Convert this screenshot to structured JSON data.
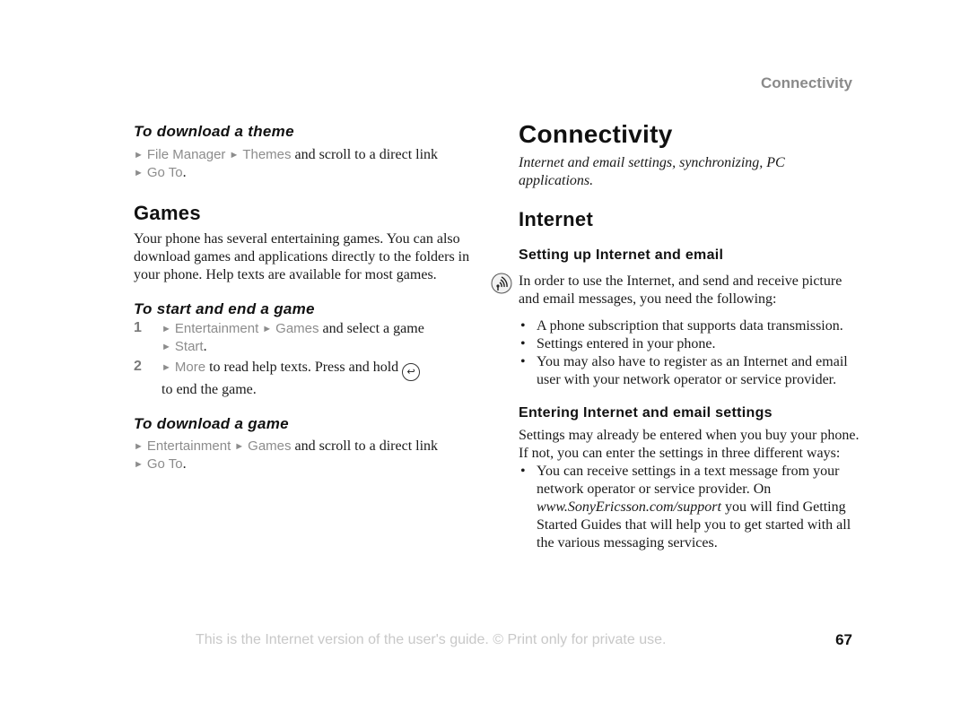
{
  "header": {
    "running_title": "Connectivity"
  },
  "left": {
    "download_theme": {
      "heading": "To download a theme",
      "menu1": "File Manager",
      "menu2": "Themes",
      "text": " and scroll to a direct link",
      "menu3": "Go To",
      "end": "."
    },
    "games": {
      "heading": "Games",
      "body": "Your phone has several entertaining games. You can also download games and applications directly to the folders in your phone. Help texts are available for most games."
    },
    "start_end_game": {
      "heading": "To start and end a game",
      "steps": [
        {
          "num": "1",
          "menu1": "Entertainment",
          "menu2": "Games",
          "text": " and select a game",
          "menu3": "Start",
          "end": "."
        },
        {
          "num": "2",
          "menu1": "More",
          "text": " to read help texts. Press and hold ",
          "icon": "back-key-icon",
          "text2": " to end the game."
        }
      ]
    },
    "download_game": {
      "heading": "To download a game",
      "menu1": "Entertainment",
      "menu2": "Games",
      "text": " and scroll to a direct link",
      "menu3": "Go To",
      "end": "."
    }
  },
  "right": {
    "title": "Connectivity",
    "subtitle": "Internet and email settings, synchronizing, PC applications.",
    "internet": {
      "heading": "Internet",
      "setup": {
        "heading": "Setting up Internet and email",
        "icon": "operator-service-icon",
        "intro": "In order to use the Internet, and send and receive picture and email messages, you need the following:",
        "bullets": [
          "A phone subscription that supports data transmission.",
          "Settings entered in your phone.",
          "You may also have to register as an Internet and email user with your network operator or service provider."
        ]
      },
      "entering": {
        "heading": "Entering Internet and email settings",
        "intro": "Settings may already be entered when you buy your phone. If not, you can enter the settings in three different ways:",
        "bullet_a": "You can receive settings in a text message from your network operator or service provider. On ",
        "bullet_link": "www.SonyEricsson.com/support",
        "bullet_b": " you will find Getting Started Guides that will help you to get started with all the various messaging services."
      }
    }
  },
  "footer": {
    "note": "This is the Internet version of the user's guide. © Print only for private use.",
    "page_number": "67"
  }
}
